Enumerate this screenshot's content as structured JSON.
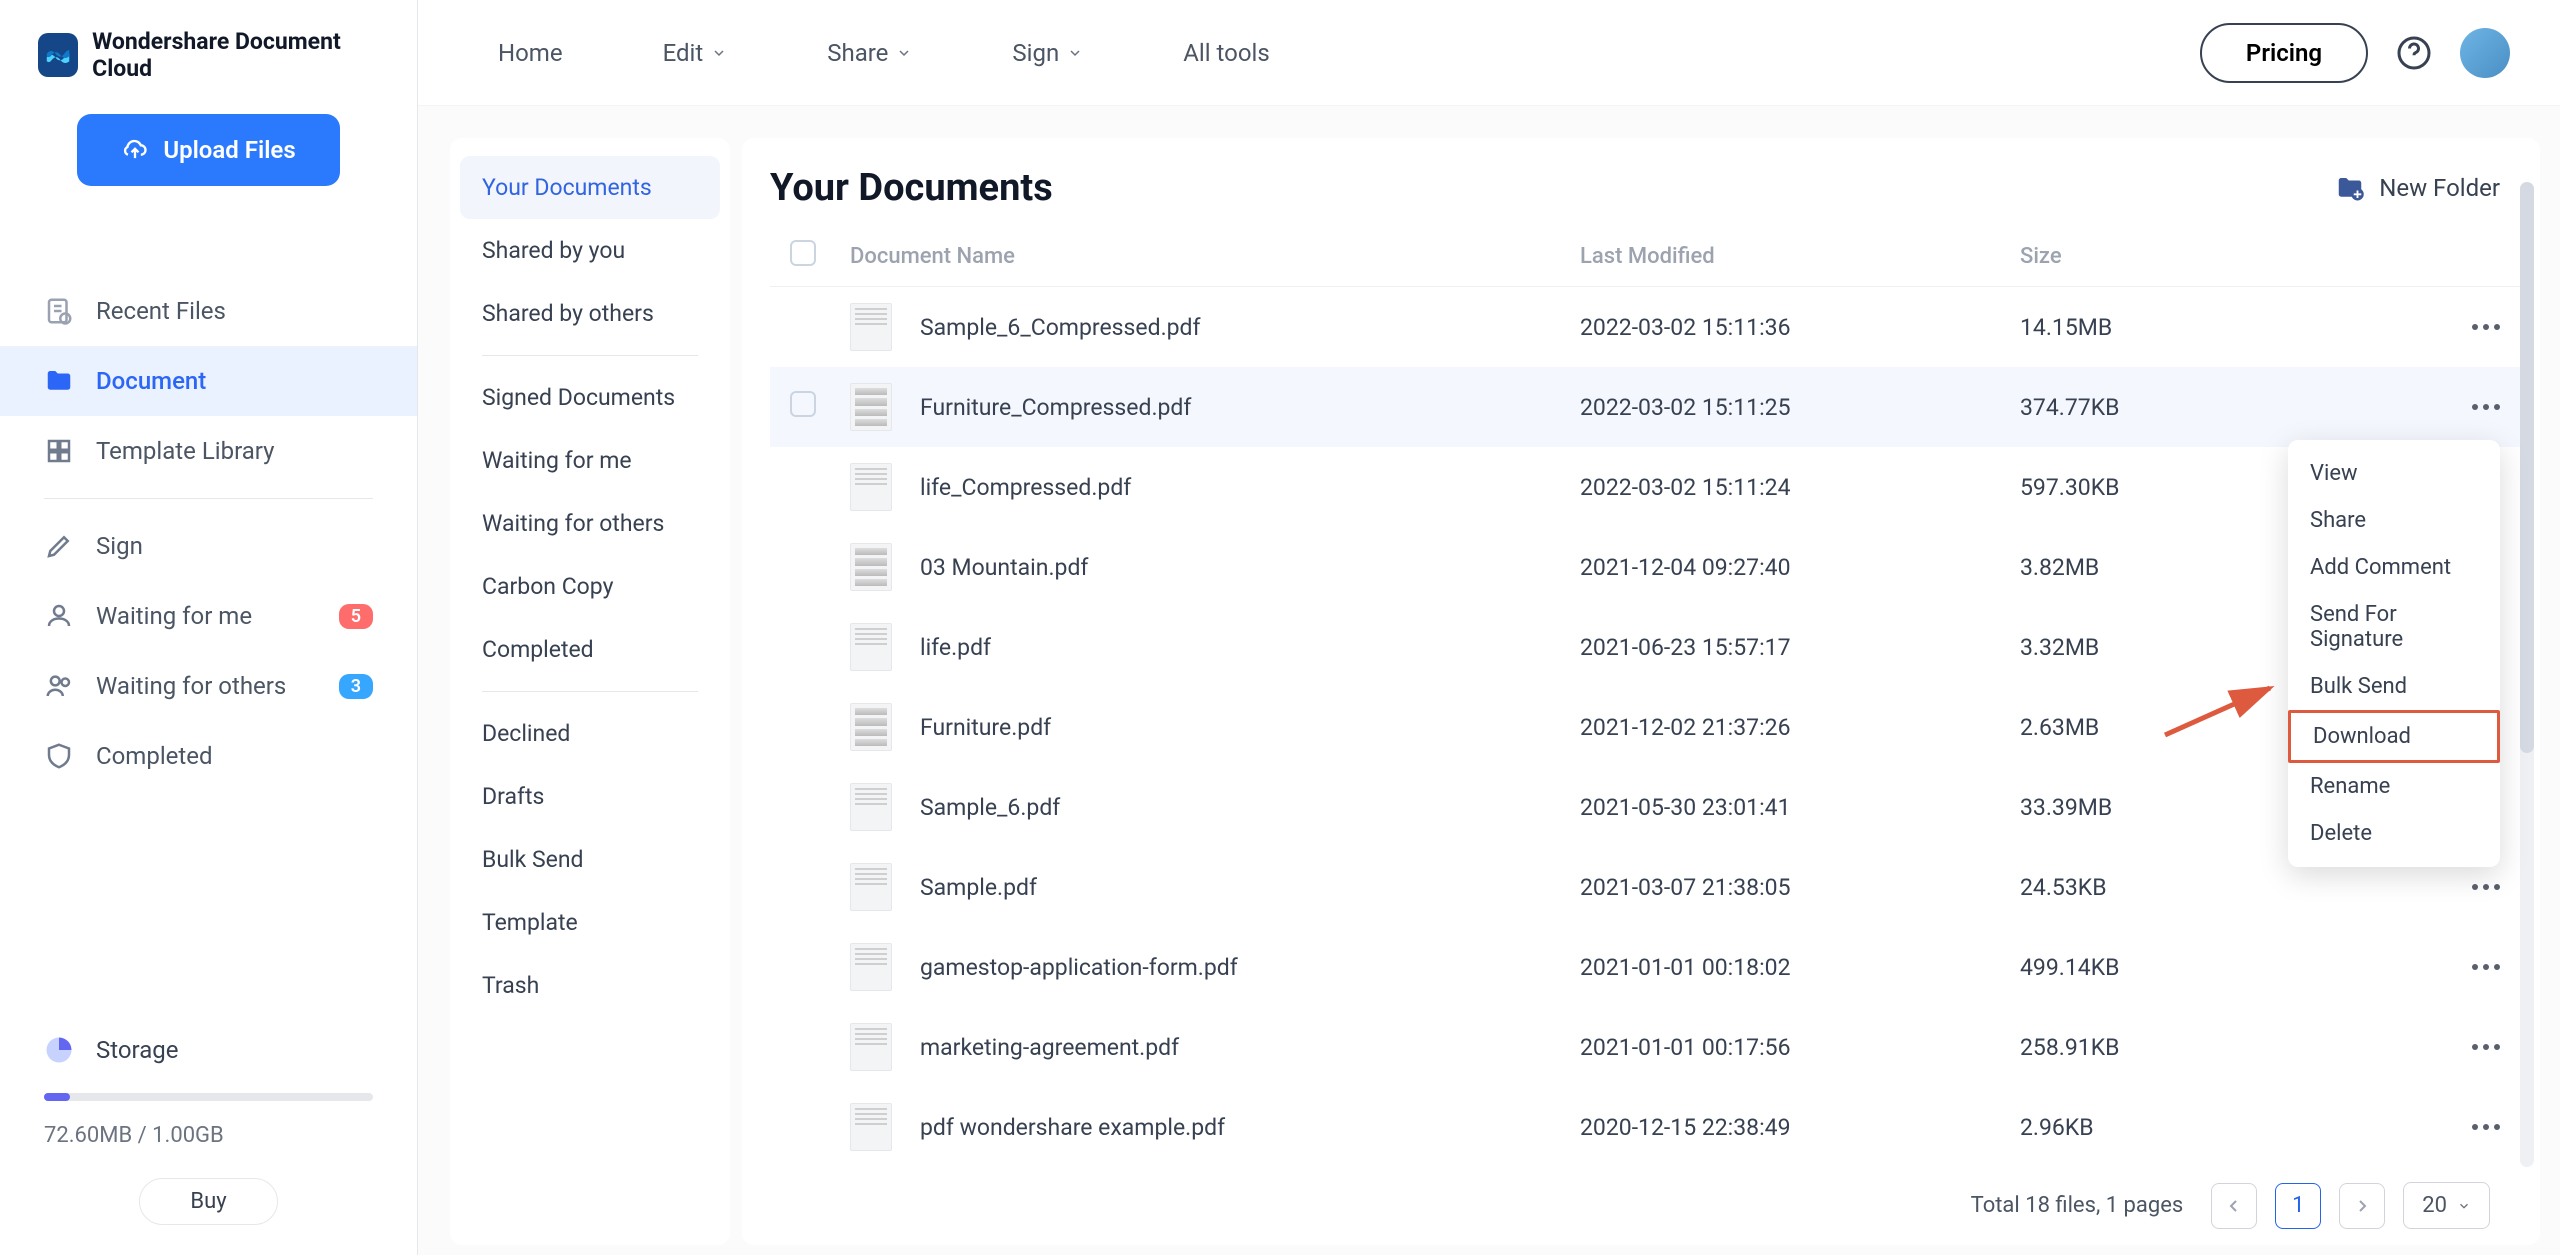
{
  "brand": "Wondershare Document Cloud",
  "upload_label": "Upload Files",
  "sidebar": {
    "recent": "Recent Files",
    "document": "Document",
    "template_lib": "Template Library",
    "sign": "Sign",
    "waiting_me": "Waiting for me",
    "waiting_me_badge": "5",
    "waiting_others": "Waiting for others",
    "waiting_others_badge": "3",
    "completed": "Completed",
    "storage": "Storage",
    "storage_usage": "72.60MB / 1.00GB",
    "buy": "Buy"
  },
  "topnav": {
    "home": "Home",
    "edit": "Edit",
    "share": "Share",
    "sign": "Sign",
    "all_tools": "All tools",
    "pricing": "Pricing"
  },
  "subnav": {
    "your_documents": "Your Documents",
    "shared_by_you": "Shared by you",
    "shared_by_others": "Shared by others",
    "signed_documents": "Signed Documents",
    "waiting_for_me": "Waiting for me",
    "waiting_for_others": "Waiting for others",
    "carbon_copy": "Carbon Copy",
    "completed": "Completed",
    "declined": "Declined",
    "drafts": "Drafts",
    "bulk_send": "Bulk Send",
    "template": "Template",
    "trash": "Trash"
  },
  "docs": {
    "title": "Your Documents",
    "new_folder": "New Folder",
    "columns": {
      "name": "Document Name",
      "modified": "Last Modified",
      "size": "Size"
    },
    "rows": [
      {
        "name": "Sample_6_Compressed.pdf",
        "modified": "2022-03-02 15:11:36",
        "size": "14.15MB"
      },
      {
        "name": "Furniture_Compressed.pdf",
        "modified": "2022-03-02 15:11:25",
        "size": "374.77KB"
      },
      {
        "name": "life_Compressed.pdf",
        "modified": "2022-03-02 15:11:24",
        "size": "597.30KB"
      },
      {
        "name": "03 Mountain.pdf",
        "modified": "2021-12-04 09:27:40",
        "size": "3.82MB"
      },
      {
        "name": "life.pdf",
        "modified": "2021-06-23 15:57:17",
        "size": "3.32MB"
      },
      {
        "name": "Furniture.pdf",
        "modified": "2021-12-02 21:37:26",
        "size": "2.63MB"
      },
      {
        "name": "Sample_6.pdf",
        "modified": "2021-05-30 23:01:41",
        "size": "33.39MB"
      },
      {
        "name": "Sample.pdf",
        "modified": "2021-03-07 21:38:05",
        "size": "24.53KB"
      },
      {
        "name": "gamestop-application-form.pdf",
        "modified": "2021-01-01 00:18:02",
        "size": "499.14KB"
      },
      {
        "name": "marketing-agreement.pdf",
        "modified": "2021-01-01 00:17:56",
        "size": "258.91KB"
      },
      {
        "name": "pdf wondershare example.pdf",
        "modified": "2020-12-15 22:38:49",
        "size": "2.96KB"
      }
    ]
  },
  "context_menu": {
    "view": "View",
    "share": "Share",
    "add_comment": "Add Comment",
    "send_signature": "Send For Signature",
    "bulk_send": "Bulk Send",
    "download": "Download",
    "rename": "Rename",
    "delete": "Delete"
  },
  "pager": {
    "summary": "Total 18 files, 1 pages",
    "current": "1",
    "page_size": "20"
  }
}
